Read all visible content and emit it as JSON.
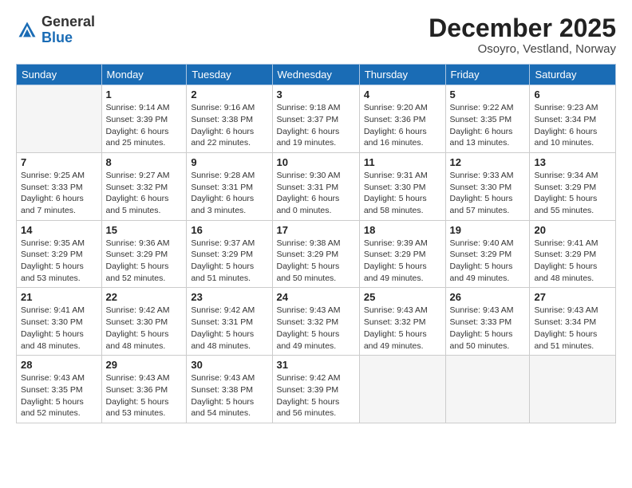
{
  "header": {
    "logo_general": "General",
    "logo_blue": "Blue",
    "month_year": "December 2025",
    "location": "Osoyro, Vestland, Norway"
  },
  "weekdays": [
    "Sunday",
    "Monday",
    "Tuesday",
    "Wednesday",
    "Thursday",
    "Friday",
    "Saturday"
  ],
  "weeks": [
    [
      {
        "day": "",
        "detail": ""
      },
      {
        "day": "1",
        "detail": "Sunrise: 9:14 AM\nSunset: 3:39 PM\nDaylight: 6 hours\nand 25 minutes."
      },
      {
        "day": "2",
        "detail": "Sunrise: 9:16 AM\nSunset: 3:38 PM\nDaylight: 6 hours\nand 22 minutes."
      },
      {
        "day": "3",
        "detail": "Sunrise: 9:18 AM\nSunset: 3:37 PM\nDaylight: 6 hours\nand 19 minutes."
      },
      {
        "day": "4",
        "detail": "Sunrise: 9:20 AM\nSunset: 3:36 PM\nDaylight: 6 hours\nand 16 minutes."
      },
      {
        "day": "5",
        "detail": "Sunrise: 9:22 AM\nSunset: 3:35 PM\nDaylight: 6 hours\nand 13 minutes."
      },
      {
        "day": "6",
        "detail": "Sunrise: 9:23 AM\nSunset: 3:34 PM\nDaylight: 6 hours\nand 10 minutes."
      }
    ],
    [
      {
        "day": "7",
        "detail": "Sunrise: 9:25 AM\nSunset: 3:33 PM\nDaylight: 6 hours\nand 7 minutes."
      },
      {
        "day": "8",
        "detail": "Sunrise: 9:27 AM\nSunset: 3:32 PM\nDaylight: 6 hours\nand 5 minutes."
      },
      {
        "day": "9",
        "detail": "Sunrise: 9:28 AM\nSunset: 3:31 PM\nDaylight: 6 hours\nand 3 minutes."
      },
      {
        "day": "10",
        "detail": "Sunrise: 9:30 AM\nSunset: 3:31 PM\nDaylight: 6 hours\nand 0 minutes."
      },
      {
        "day": "11",
        "detail": "Sunrise: 9:31 AM\nSunset: 3:30 PM\nDaylight: 5 hours\nand 58 minutes."
      },
      {
        "day": "12",
        "detail": "Sunrise: 9:33 AM\nSunset: 3:30 PM\nDaylight: 5 hours\nand 57 minutes."
      },
      {
        "day": "13",
        "detail": "Sunrise: 9:34 AM\nSunset: 3:29 PM\nDaylight: 5 hours\nand 55 minutes."
      }
    ],
    [
      {
        "day": "14",
        "detail": "Sunrise: 9:35 AM\nSunset: 3:29 PM\nDaylight: 5 hours\nand 53 minutes."
      },
      {
        "day": "15",
        "detail": "Sunrise: 9:36 AM\nSunset: 3:29 PM\nDaylight: 5 hours\nand 52 minutes."
      },
      {
        "day": "16",
        "detail": "Sunrise: 9:37 AM\nSunset: 3:29 PM\nDaylight: 5 hours\nand 51 minutes."
      },
      {
        "day": "17",
        "detail": "Sunrise: 9:38 AM\nSunset: 3:29 PM\nDaylight: 5 hours\nand 50 minutes."
      },
      {
        "day": "18",
        "detail": "Sunrise: 9:39 AM\nSunset: 3:29 PM\nDaylight: 5 hours\nand 49 minutes."
      },
      {
        "day": "19",
        "detail": "Sunrise: 9:40 AM\nSunset: 3:29 PM\nDaylight: 5 hours\nand 49 minutes."
      },
      {
        "day": "20",
        "detail": "Sunrise: 9:41 AM\nSunset: 3:29 PM\nDaylight: 5 hours\nand 48 minutes."
      }
    ],
    [
      {
        "day": "21",
        "detail": "Sunrise: 9:41 AM\nSunset: 3:30 PM\nDaylight: 5 hours\nand 48 minutes."
      },
      {
        "day": "22",
        "detail": "Sunrise: 9:42 AM\nSunset: 3:30 PM\nDaylight: 5 hours\nand 48 minutes."
      },
      {
        "day": "23",
        "detail": "Sunrise: 9:42 AM\nSunset: 3:31 PM\nDaylight: 5 hours\nand 48 minutes."
      },
      {
        "day": "24",
        "detail": "Sunrise: 9:43 AM\nSunset: 3:32 PM\nDaylight: 5 hours\nand 49 minutes."
      },
      {
        "day": "25",
        "detail": "Sunrise: 9:43 AM\nSunset: 3:32 PM\nDaylight: 5 hours\nand 49 minutes."
      },
      {
        "day": "26",
        "detail": "Sunrise: 9:43 AM\nSunset: 3:33 PM\nDaylight: 5 hours\nand 50 minutes."
      },
      {
        "day": "27",
        "detail": "Sunrise: 9:43 AM\nSunset: 3:34 PM\nDaylight: 5 hours\nand 51 minutes."
      }
    ],
    [
      {
        "day": "28",
        "detail": "Sunrise: 9:43 AM\nSunset: 3:35 PM\nDaylight: 5 hours\nand 52 minutes."
      },
      {
        "day": "29",
        "detail": "Sunrise: 9:43 AM\nSunset: 3:36 PM\nDaylight: 5 hours\nand 53 minutes."
      },
      {
        "day": "30",
        "detail": "Sunrise: 9:43 AM\nSunset: 3:38 PM\nDaylight: 5 hours\nand 54 minutes."
      },
      {
        "day": "31",
        "detail": "Sunrise: 9:42 AM\nSunset: 3:39 PM\nDaylight: 5 hours\nand 56 minutes."
      },
      {
        "day": "",
        "detail": ""
      },
      {
        "day": "",
        "detail": ""
      },
      {
        "day": "",
        "detail": ""
      }
    ]
  ]
}
